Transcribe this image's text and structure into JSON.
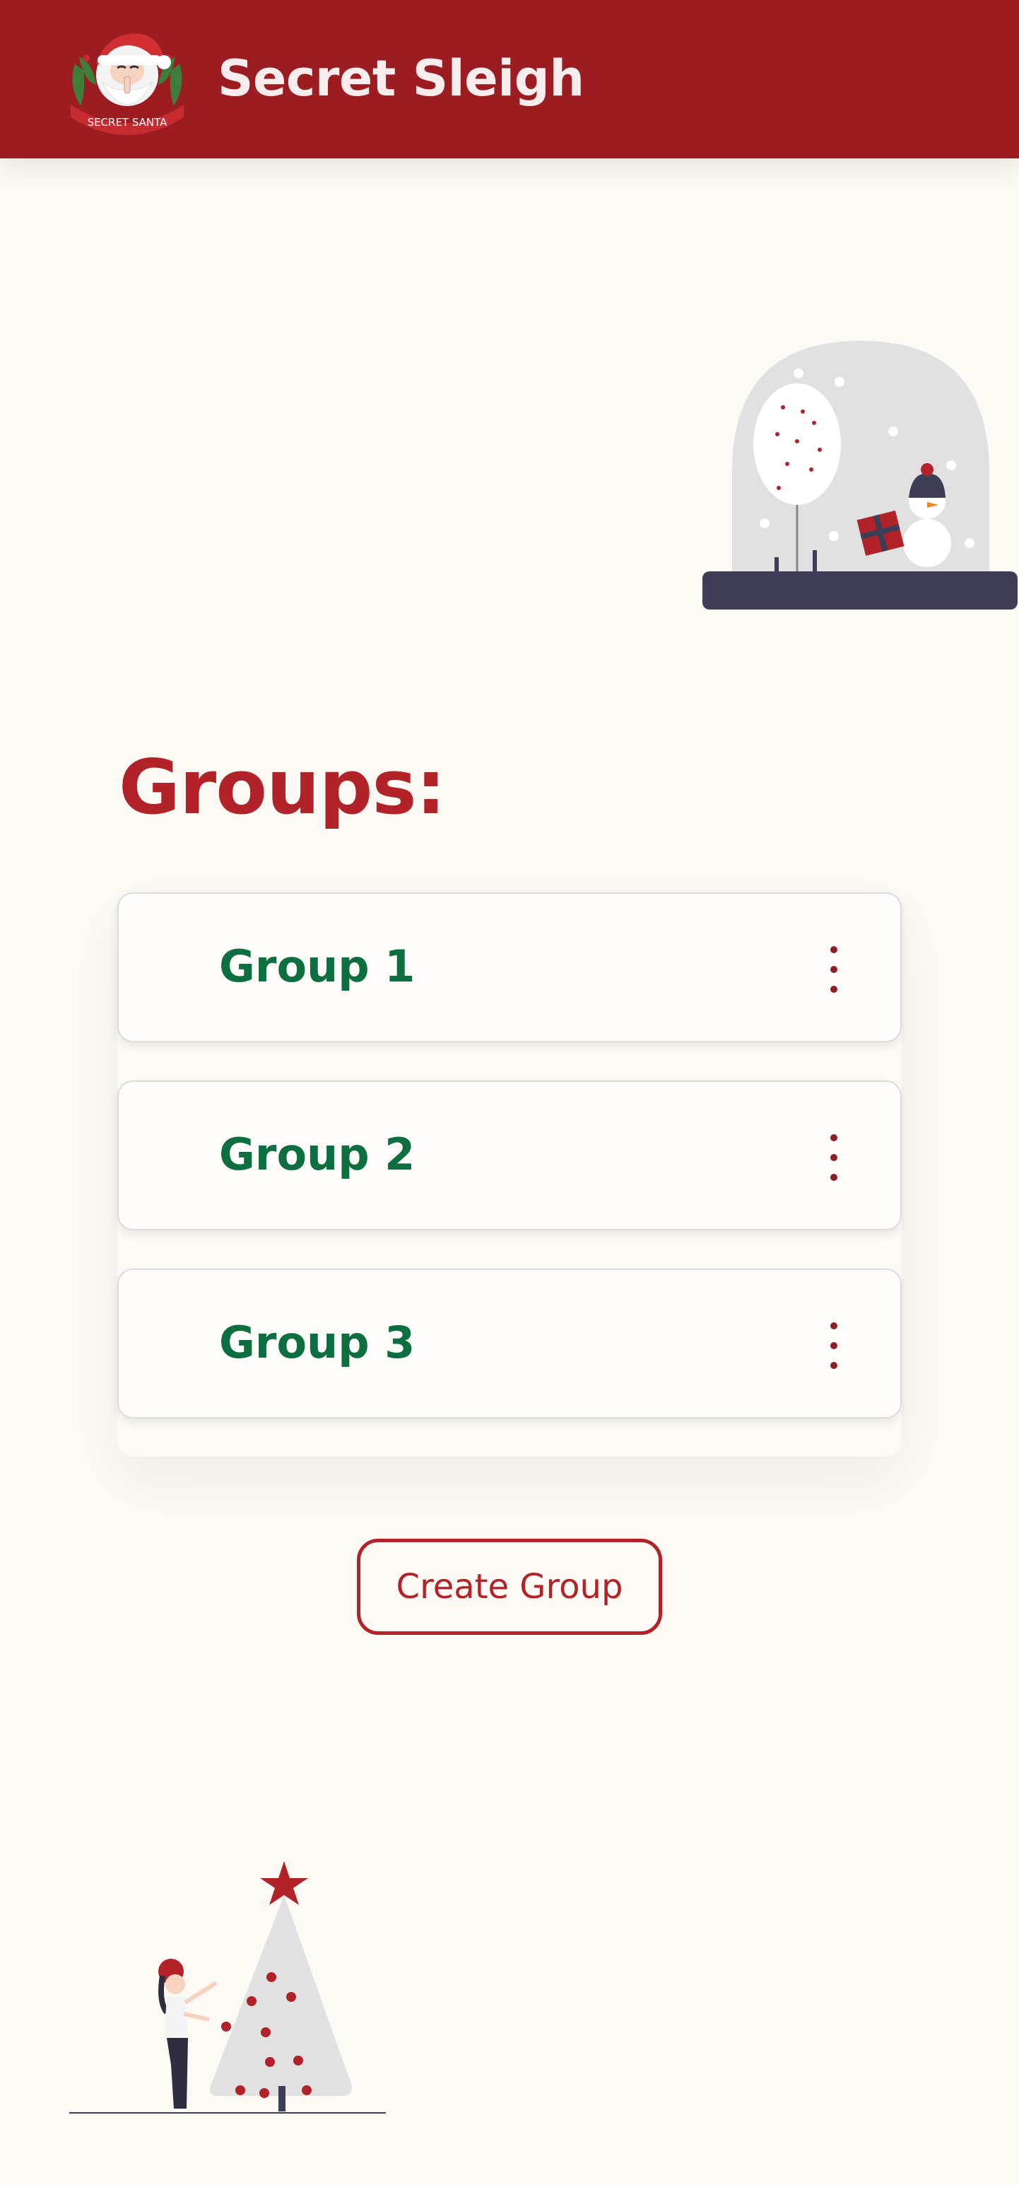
{
  "header": {
    "app_title": "Secret Sleigh",
    "logo_text": "SECRET SANTA",
    "background_color": "#9b1d22"
  },
  "main": {
    "title": "Groups:",
    "groups": [
      {
        "name": "Group 1",
        "menu_icon": "more-vertical-icon"
      },
      {
        "name": "Group 2",
        "menu_icon": "more-vertical-icon"
      },
      {
        "name": "Group 3",
        "menu_icon": "more-vertical-icon"
      }
    ],
    "create_button_label": "Create Group"
  },
  "colors": {
    "accent_red": "#b22229",
    "group_green": "#0d6e3f",
    "page_background": "#fdfaf5"
  },
  "illustrations": [
    "santa-logo",
    "snow-globe-illustration",
    "christmas-tree-illustration"
  ]
}
